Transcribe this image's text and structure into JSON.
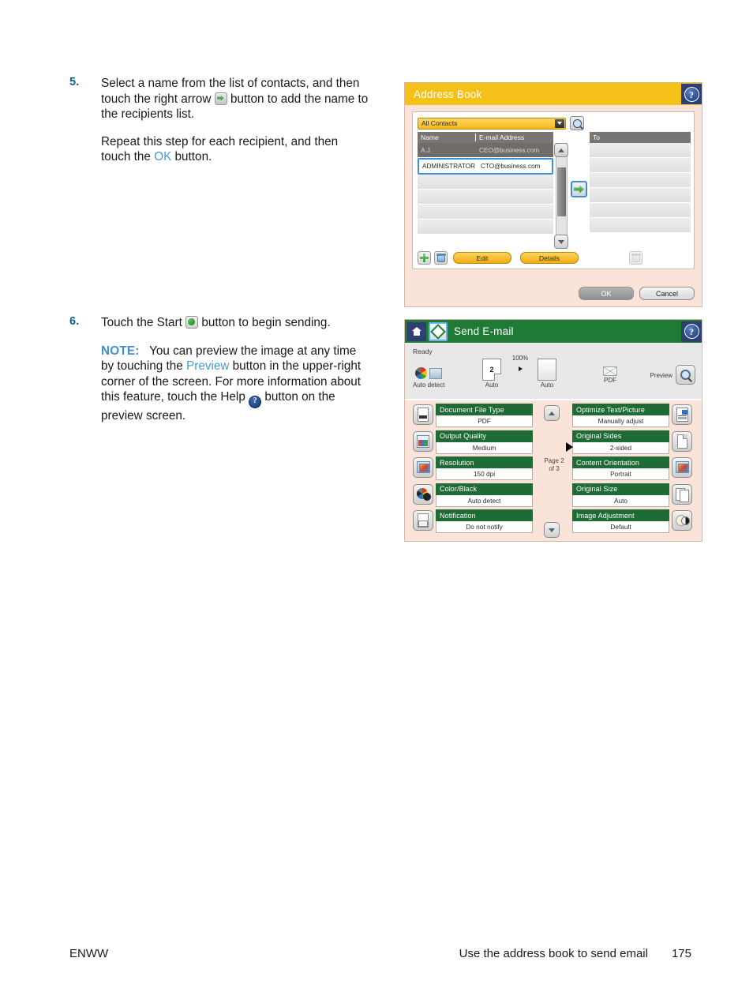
{
  "document": {
    "footer": {
      "left": "ENWW",
      "section_title": "Use the address book to send email",
      "page_number": "175"
    }
  },
  "steps": [
    {
      "number": "5.",
      "para1_a": "Select a name from the list of contacts, and then touch the right arrow ",
      "para1_b": " button to add the name to the recipients list.",
      "para2_a": "Repeat this step for each recipient, and then touch the ",
      "para2_link": "OK",
      "para2_b": " button."
    },
    {
      "number": "6.",
      "para1_a": "Touch the Start ",
      "para1_b": " button to begin sending.",
      "note_label": "NOTE:",
      "note_a": "You can preview the image at any time by touching the ",
      "note_link": "Preview",
      "note_b": " button in the upper-right corner of the screen. For more information about this feature, touch the Help ",
      "note_c": " button on the preview screen."
    }
  ],
  "address_book": {
    "title": "Address Book",
    "help_glyph": "?",
    "filter": {
      "selected": "All Contacts",
      "options": [
        "All Contacts"
      ]
    },
    "search_icon": "search-icon",
    "columns": [
      "Name",
      "E-mail Address"
    ],
    "contacts": [
      {
        "name": "A.J.",
        "email": "CEO@business.com",
        "state": "selected-grey"
      },
      {
        "name": "ADMINISTRATOR",
        "email": "CTO@business.com",
        "state": "highlighted"
      },
      {
        "name": "",
        "email": "",
        "state": "empty"
      },
      {
        "name": "",
        "email": "",
        "state": "empty"
      },
      {
        "name": "",
        "email": "",
        "state": "empty"
      },
      {
        "name": "",
        "email": "",
        "state": "empty"
      }
    ],
    "recipients_header": "To",
    "recipients": [
      "",
      "",
      "",
      "",
      "",
      ""
    ],
    "add_arrow_icon": "right-arrow-icon",
    "toolbar": {
      "add_label": "add-contact",
      "delete_label": "delete-contact",
      "edit_label": "Edit",
      "details_label": "Details",
      "remove_recipient_label": "remove-recipient"
    },
    "footer_buttons": {
      "ok": "OK",
      "cancel": "Cancel"
    }
  },
  "send_email": {
    "title": "Send E-mail",
    "help_glyph": "?",
    "home_icon": "home-icon",
    "start_icon": "start-icon",
    "status": "Ready",
    "toolbar": [
      {
        "caption": "Auto detect",
        "icon": "color-detect-icon"
      },
      {
        "caption": "Auto",
        "icon": "original-sides-icon",
        "badge": "2"
      },
      {
        "caption": "Auto",
        "icon": "output-sheet-icon"
      },
      {
        "caption": "PDF",
        "icon": "file-type-icon"
      }
    ],
    "zoom_percent": "100%",
    "preview_label": "Preview",
    "preview_icon": "magnifier-icon",
    "page_indicator_line1": "Page 2",
    "page_indicator_line2": "of 3",
    "scroll_up_icon": "chevron-up-icon",
    "scroll_down_icon": "chevron-down-icon",
    "settings_left": [
      {
        "label": "Document File Type",
        "value": "PDF",
        "icon": "document-file-type-icon"
      },
      {
        "label": "Output Quality",
        "value": "Medium",
        "icon": "output-quality-icon"
      },
      {
        "label": "Resolution",
        "value": "150 dpi",
        "icon": "resolution-icon"
      },
      {
        "label": "Color/Black",
        "value": "Auto detect",
        "icon": "color-black-icon"
      },
      {
        "label": "Notification",
        "value": "Do not notify",
        "icon": "notification-icon"
      }
    ],
    "settings_right": [
      {
        "label": "Optimize Text/Picture",
        "value": "Manually adjust",
        "icon": "optimize-text-picture-icon",
        "pointer": false
      },
      {
        "label": "Original Sides",
        "value": "2-sided",
        "icon": "original-sides-icon",
        "pointer": true
      },
      {
        "label": "Content Orientation",
        "value": "Portrait",
        "icon": "content-orientation-icon",
        "pointer": false
      },
      {
        "label": "Original Size",
        "value": "Auto",
        "icon": "original-size-icon",
        "pointer": false
      },
      {
        "label": "Image Adjustment",
        "value": "Default",
        "icon": "image-adjustment-icon",
        "pointer": false
      }
    ]
  },
  "colors": {
    "address_book_header": "#f5c018",
    "send_email_header": "#1f7a35",
    "panel_background": "#fae3d8",
    "setting_label_green": "#1f6b35",
    "help_badge_blue": "#2e3f73",
    "link_blue": "#4a9bd4",
    "note_blue": "#3e8fc9",
    "step_number_blue": "#0d5f8a",
    "highlight_border": "#3f8fd6"
  }
}
